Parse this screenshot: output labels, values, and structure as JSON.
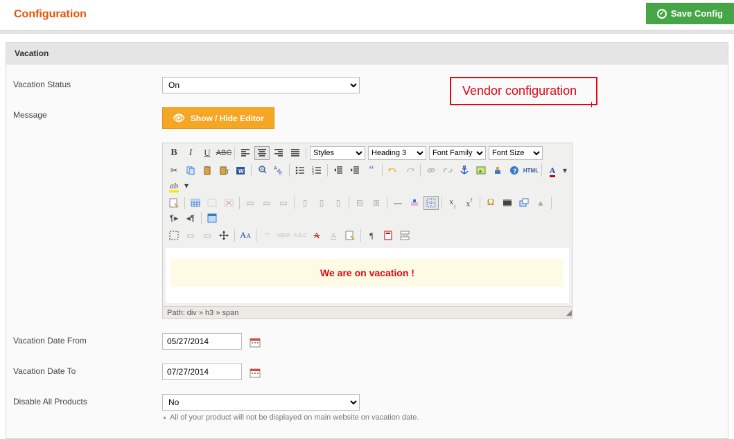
{
  "header": {
    "title": "Configuration",
    "save_label": "Save Config"
  },
  "annotation": "Vendor configuration",
  "panel": {
    "title": "Vacation"
  },
  "form": {
    "status_label": "Vacation Status",
    "status_value": "On",
    "message_label": "Message",
    "toggle_editor_label": "Show / Hide Editor",
    "date_from_label": "Vacation Date From",
    "date_from_value": "05/27/2014",
    "date_to_label": "Vacation Date To",
    "date_to_value": "07/27/2014",
    "disable_label": "Disable All Products",
    "disable_value": "No",
    "disable_hint": "All of your product will not be displayed on main website on vacation date."
  },
  "editor": {
    "selects": {
      "styles": "Styles",
      "format": "Heading 3",
      "font_family": "Font Family",
      "font_size": "Font Size"
    },
    "content_text": "We are on vacation !",
    "path_line": "Path: div » h3 » span",
    "html_label": "HTML",
    "icons_row1": [
      "bold",
      "italic",
      "underline",
      "strike",
      "align-left",
      "align-center",
      "align-right",
      "align-justify"
    ],
    "icons_row2": [
      "cut",
      "copy",
      "paste",
      "paste-text",
      "paste-word",
      "find",
      "replace",
      "bullets",
      "numbered",
      "outdent",
      "indent",
      "quote",
      "undo",
      "redo",
      "link",
      "unlink",
      "anchor",
      "image",
      "cleanup",
      "help",
      "html",
      "forecolor",
      "backcolor"
    ],
    "icons_row3": [
      "edit-html",
      "table",
      "row-before",
      "row-after",
      "row-delete",
      "col-before",
      "col-after",
      "col-delete",
      "split",
      "merge",
      "hr",
      "eraser",
      "grid",
      "subscript",
      "superscript",
      "omega",
      "media",
      "layer-forward",
      "layer-back",
      "ltr",
      "rtl",
      "absolute"
    ],
    "icons_row4": [
      "crop",
      "layer-add",
      "layer-del",
      "move",
      "font-aa",
      "cite",
      "abbr",
      "acronym",
      "del-tag",
      "ins-tag",
      "attribs",
      "pilcrow",
      "template",
      "pagebreak"
    ]
  }
}
